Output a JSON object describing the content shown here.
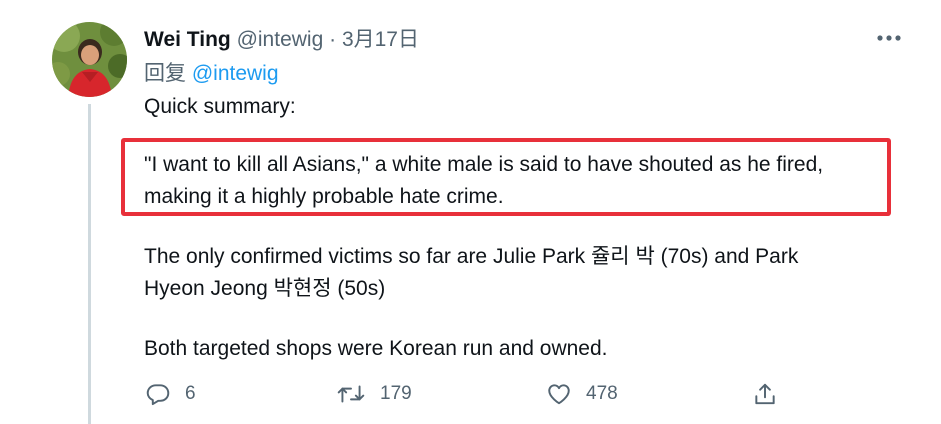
{
  "tweet": {
    "author_name": "Wei Ting",
    "handle": "@intewig",
    "separator": "·",
    "date": "3月17日",
    "reply_label": "回复",
    "reply_to": "@intewig",
    "paragraphs": [
      [
        "Quick summary:"
      ],
      [
        "\"I want to kill all Asians,\" a white male is said to have shouted as he fired,",
        "making it a highly probable hate crime."
      ],
      [
        "The only confirmed victims so far are Julie Park 쥴리 박 (70s) and Park",
        "Hyeon Jeong 박현정 (50s)"
      ],
      [
        "Both targeted shops were Korean run and owned."
      ]
    ],
    "highlight_color": "#e8303a",
    "actions": {
      "reply_count": "6",
      "retweet_count": "179",
      "like_count": "478"
    },
    "icons": {
      "more": "more-horizontal-icon",
      "reply": "reply-icon",
      "retweet": "retweet-icon",
      "like": "heart-icon",
      "share": "share-icon"
    },
    "colors": {
      "text": "#0f1419",
      "secondary": "#536471",
      "link": "#1d9bf0",
      "thread_line": "#cfd9de"
    }
  }
}
